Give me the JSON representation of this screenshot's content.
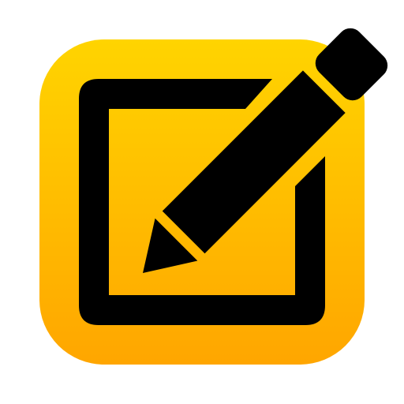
{
  "app_icon": {
    "icon": "edit-pencil-square-icon",
    "colors": {
      "page_background": "#ffffff",
      "tile_gradient_top": "#FFD400",
      "tile_gradient_bottom": "#FFA600",
      "glyph": "#000000"
    }
  }
}
